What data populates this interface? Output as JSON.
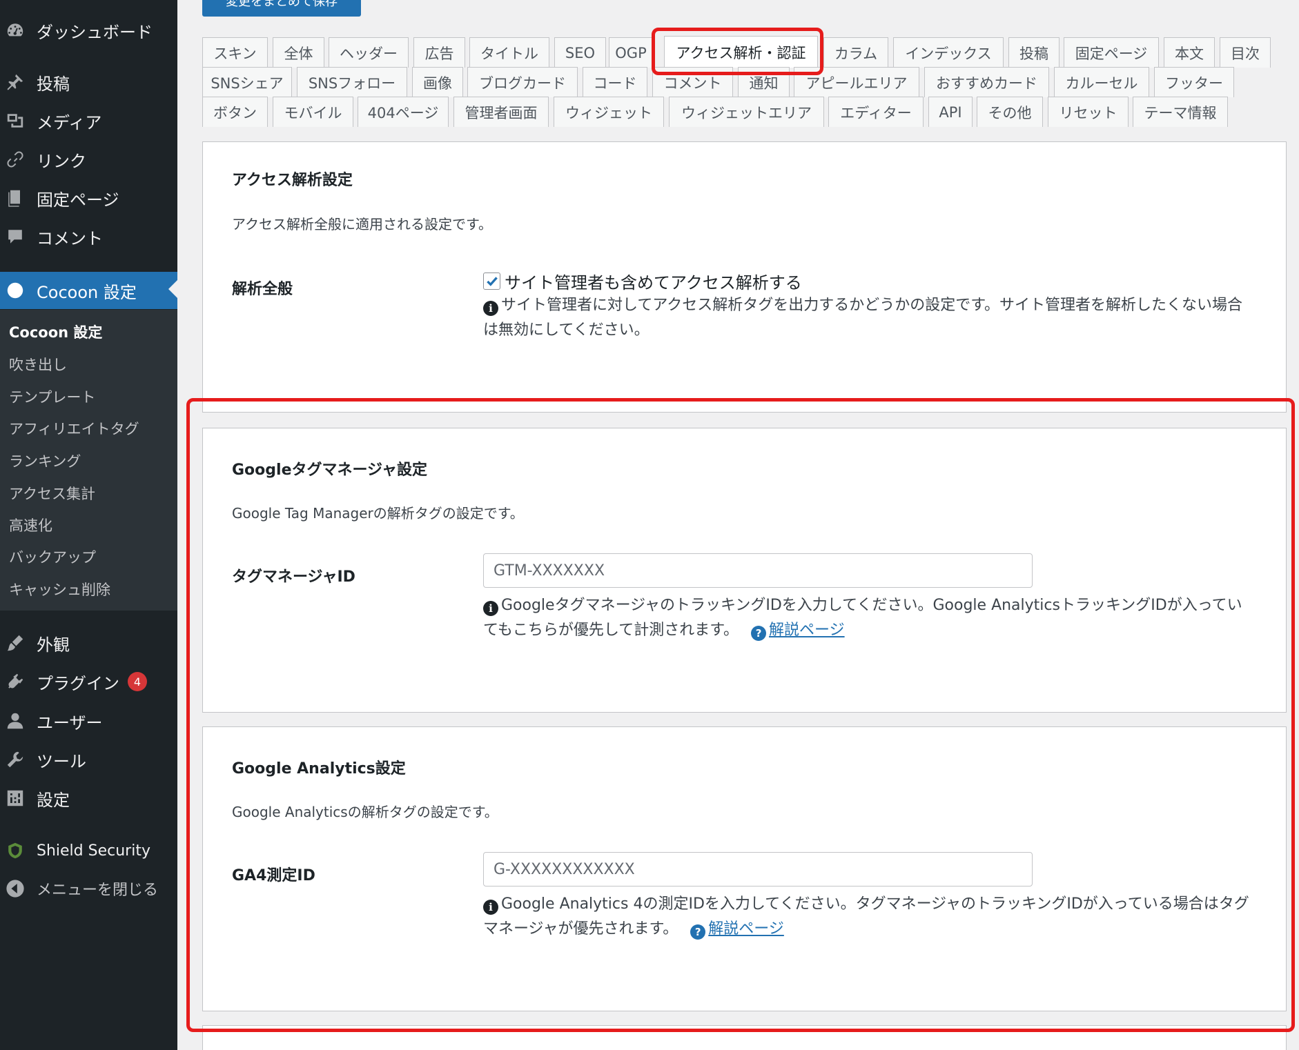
{
  "sidebar": {
    "top_items": [
      {
        "label": "ダッシュボード",
        "icon": "dashboard-icon"
      },
      {
        "label": "投稿",
        "icon": "pin-icon"
      },
      {
        "label": "メディア",
        "icon": "media-icon"
      },
      {
        "label": "リンク",
        "icon": "link-icon"
      },
      {
        "label": "固定ページ",
        "icon": "page-icon"
      },
      {
        "label": "コメント",
        "icon": "comment-icon"
      }
    ],
    "active_item": {
      "label": "Cocoon 設定",
      "icon": "circle-icon"
    },
    "submenu": [
      {
        "label": "Cocoon 設定"
      },
      {
        "label": "吹き出し"
      },
      {
        "label": "テンプレート"
      },
      {
        "label": "アフィリエイトタグ"
      },
      {
        "label": "ランキング"
      },
      {
        "label": "アクセス集計"
      },
      {
        "label": "高速化"
      },
      {
        "label": "バックアップ"
      },
      {
        "label": "キャッシュ削除"
      }
    ],
    "bottom_items": [
      {
        "label": "外観",
        "icon": "brush-icon"
      },
      {
        "label": "プラグイン",
        "icon": "plugin-icon",
        "badge": "4"
      },
      {
        "label": "ユーザー",
        "icon": "user-icon"
      },
      {
        "label": "ツール",
        "icon": "wrench-icon"
      },
      {
        "label": "設定",
        "icon": "settings-icon"
      }
    ],
    "shield": {
      "label": "Shield Security",
      "icon": "shield-icon"
    },
    "collapse": {
      "label": "メニューを閉じる",
      "icon": "collapse-arrow-icon"
    }
  },
  "save_button": {
    "label": "変更をまとめて保存"
  },
  "tabs": {
    "row1": [
      "スキン",
      "全体",
      "ヘッダー",
      "広告",
      "タイトル",
      "SEO",
      "OGP",
      "アクセス解析・認証",
      "カラム",
      "インデックス",
      "投稿",
      "固定ページ",
      "本文",
      "目次"
    ],
    "row2": [
      "SNSシェア",
      "SNSフォロー",
      "画像",
      "ブログカード",
      "コード",
      "コメント",
      "通知",
      "アピールエリア",
      "おすすめカード",
      "カルーセル",
      "フッター"
    ],
    "row3": [
      "ボタン",
      "モバイル",
      "404ページ",
      "管理者画面",
      "ウィジェット",
      "ウィジェットエリア",
      "エディター",
      "API",
      "その他",
      "リセット",
      "テーマ情報"
    ],
    "active": "アクセス解析・認証"
  },
  "access_panel": {
    "title": "アクセス解析設定",
    "description": "アクセス解析全般に適用される設定です。",
    "field_label": "解析全般",
    "checkbox_label": "サイト管理者も含めてアクセス解析する",
    "checkbox_checked": true,
    "help": "サイト管理者に対してアクセス解析タグを出力するかどうかの設定です。サイト管理者を解析したくない場合は無効にしてください。"
  },
  "gtm_panel": {
    "title": "Googleタグマネージャ設定",
    "description": "Google Tag Managerの解析タグの設定です。",
    "field_label": "タグマネージャID",
    "placeholder": "GTM-XXXXXXX",
    "help": "Googleタグマネージャのトラッキングを入力してください。Google Analyticsトラッキングが入っていてもこちらが優先して計測されます。",
    "help_text": "Googleタグマネージャのトラッキングを入力してください。Google Analyticsトラッキングが入っていてもこちらが優先して計測されます。",
    "help_full": "Googleタグマネージャのトラッキングを入力してください。",
    "help_line": "Googleタグマネージャのトラッキングを入力してください。",
    "help_display": "GoogleタグマネージャのトラッキングIDを入力してください。Google AnalyticsトラッキングIDが入っていてもこちらが優先して計測されます。",
    "link_label": "解説ページ"
  },
  "ga_panel": {
    "title": "Google Analytics設定",
    "description": "Google Analyticsの解析タグの設定です。",
    "field_label": "GA4測定ID",
    "placeholder": "G-XXXXXXXXXXXX",
    "help_display": "Google Analytics 4の測定IDを入力してください。タグマネージャのトラッキングIDが入っている場合はタグマネージャが優先されます。",
    "link_label": "解説ページ"
  },
  "colors": {
    "sidebar_bg": "#1d2327",
    "accent": "#2271b1",
    "highlight": "#e61c1c"
  }
}
